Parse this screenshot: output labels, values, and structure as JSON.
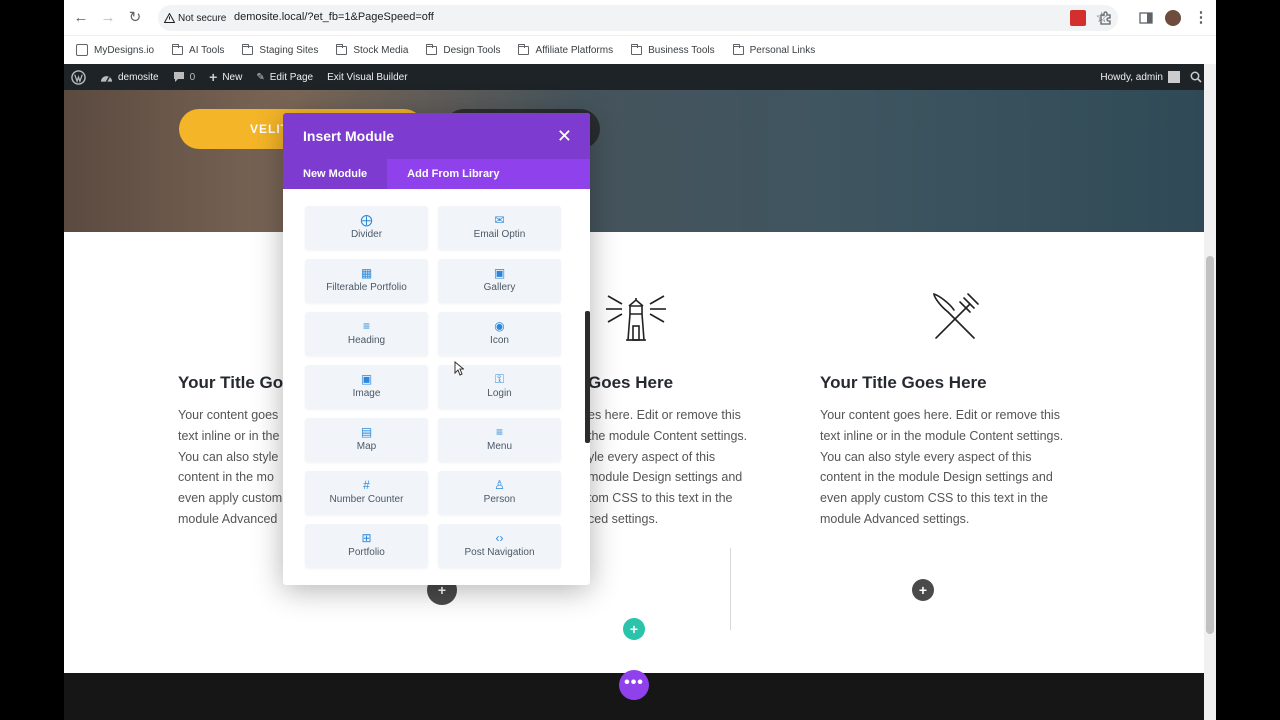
{
  "browser": {
    "security_label": "Not secure",
    "url": "demosite.local/?et_fb=1&PageSpeed=off"
  },
  "bookmarks": [
    {
      "label": "MyDesigns.io",
      "icon": "site-favicon"
    },
    {
      "label": "AI Tools",
      "icon": "folder-icon"
    },
    {
      "label": "Staging Sites",
      "icon": "folder-icon"
    },
    {
      "label": "Stock Media",
      "icon": "folder-icon"
    },
    {
      "label": "Design Tools",
      "icon": "folder-icon"
    },
    {
      "label": "Affiliate Platforms",
      "icon": "folder-icon"
    },
    {
      "label": "Business Tools",
      "icon": "folder-icon"
    },
    {
      "label": "Personal Links",
      "icon": "folder-icon"
    }
  ],
  "wp_bar": {
    "site_name": "demosite",
    "comments_count": "0",
    "new_label": "New",
    "edit_page_label": "Edit Page",
    "exit_builder_label": "Exit Visual Builder",
    "howdy": "Howdy, admin"
  },
  "hero": {
    "button_text": "VELIT"
  },
  "blurbs": [
    {
      "title": "Your Title Go",
      "text": "Your content goes\ntext inline or in the\nYou can also style\ncontent in the mo\neven apply custom\nmodule Advanced"
    },
    {
      "title": "Goes Here",
      "text": "es here. Edit or remove this\nthe module Content settings.\nyle every aspect of this\nmodule Design settings and\ntom CSS to this text in the\nced settings."
    },
    {
      "title": "Your Title Goes Here",
      "text": "Your content goes here. Edit or remove this\ntext inline or in the module Content settings.\nYou can also style every aspect of this\ncontent in the module Design settings and\neven apply custom CSS to this text in the\nmodule Advanced settings."
    }
  ],
  "modal": {
    "title": "Insert Module",
    "tabs": [
      "New Module",
      "Add From Library"
    ],
    "modules": [
      {
        "label": "Divider",
        "icon": "divider-icon"
      },
      {
        "label": "Email Optin",
        "icon": "email-icon"
      },
      {
        "label": "Filterable Portfolio",
        "icon": "grid-icon"
      },
      {
        "label": "Gallery",
        "icon": "gallery-icon"
      },
      {
        "label": "Heading",
        "icon": "heading-icon"
      },
      {
        "label": "Icon",
        "icon": "target-icon"
      },
      {
        "label": "Image",
        "icon": "image-icon"
      },
      {
        "label": "Login",
        "icon": "lock-icon"
      },
      {
        "label": "Map",
        "icon": "map-icon"
      },
      {
        "label": "Menu",
        "icon": "menu-icon"
      },
      {
        "label": "Number Counter",
        "icon": "hash-icon"
      },
      {
        "label": "Person",
        "icon": "person-icon"
      },
      {
        "label": "Portfolio",
        "icon": "portfolio-icon"
      },
      {
        "label": "Post Navigation",
        "icon": "code-icon"
      }
    ]
  },
  "colors": {
    "divi_purple": "#7e3bd0",
    "divi_tab_purple": "#8f42ec",
    "hero_button": "#f4b528",
    "add_row_green": "#29c4a9",
    "module_icon_blue": "#2b87da"
  }
}
